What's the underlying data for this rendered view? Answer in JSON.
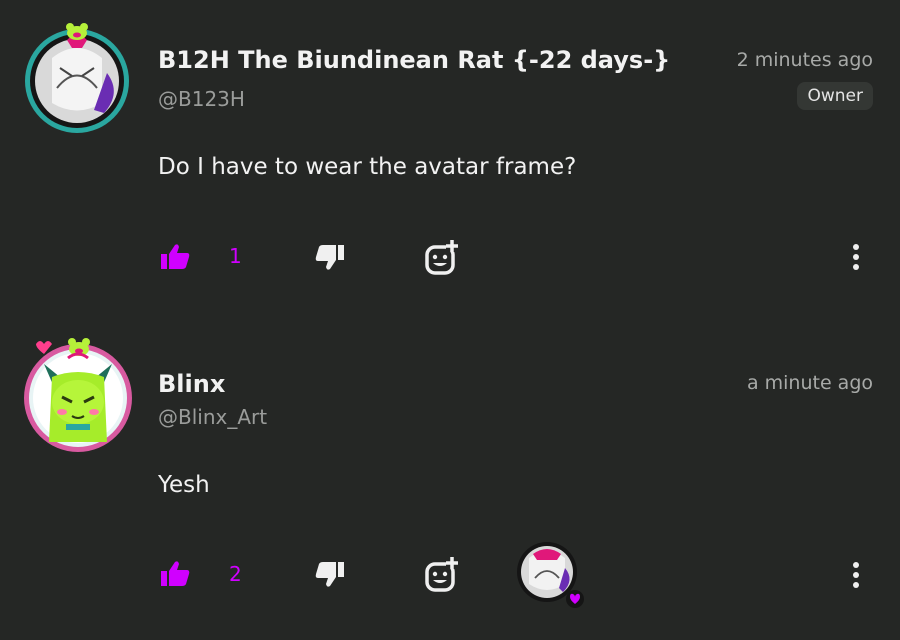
{
  "colors": {
    "background": "#252725",
    "accent": "#d000ff",
    "text": "#f2f2f2",
    "muted": "#9a9c9a"
  },
  "comments": [
    {
      "author": "B12H The Biundinean Rat {-22 days-}",
      "handle": "@B123H",
      "time": "2 minutes ago",
      "badge": "Owner",
      "text": "Do I have to wear the avatar frame?",
      "likes": "1",
      "icons": [
        "thumbs-up-icon",
        "thumbs-down-icon",
        "add-reaction-icon",
        "more-vertical-icon"
      ]
    },
    {
      "author": "Blinx",
      "handle": "@Blinx_Art",
      "time": "a minute ago",
      "text": "Yesh",
      "likes": "2",
      "icons": [
        "thumbs-up-icon",
        "thumbs-down-icon",
        "add-reaction-icon",
        "creator-heart-icon",
        "more-vertical-icon"
      ]
    }
  ]
}
